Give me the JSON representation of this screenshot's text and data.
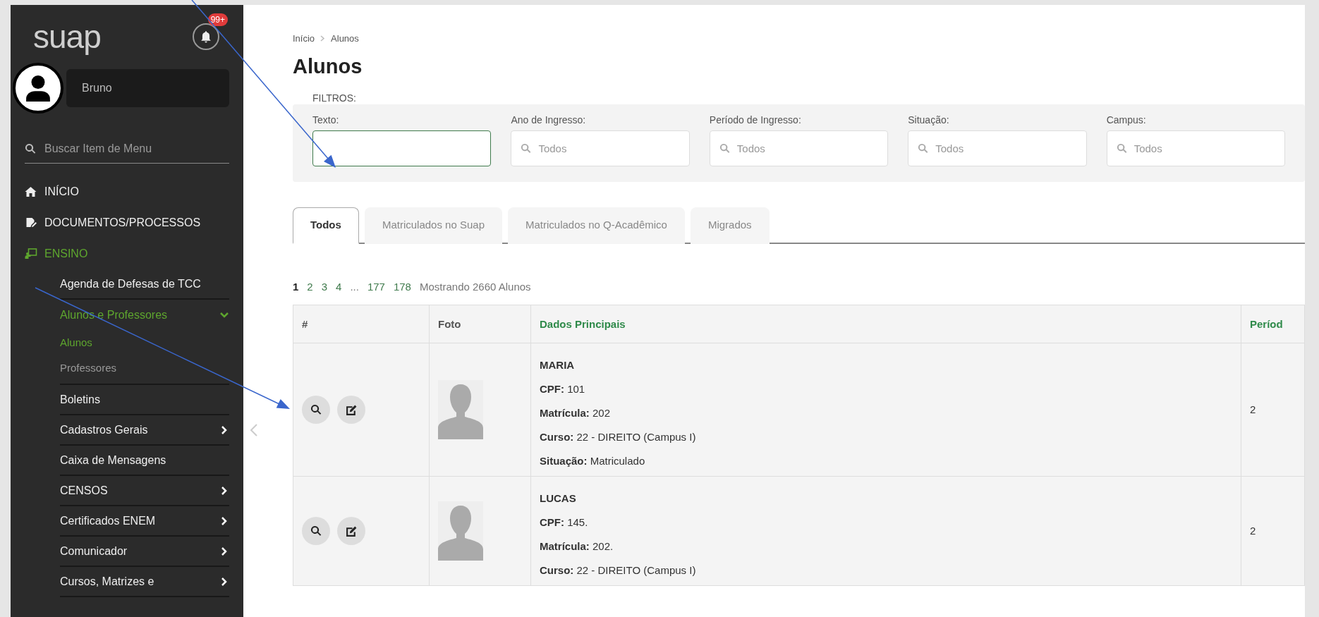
{
  "sidebar": {
    "logo": "suap",
    "notifications_badge": "99+",
    "user": {
      "name": "Bruno"
    },
    "search": {
      "placeholder": "Buscar Item de Menu"
    },
    "menu": [
      {
        "label": "INÍCIO",
        "selected": false
      },
      {
        "label": "DOCUMENTOS/PROCESSOS",
        "selected": false
      },
      {
        "label": "ENSINO",
        "selected": true,
        "children": [
          {
            "label": "Agenda de Defesas de TCC",
            "selected": false
          },
          {
            "label": "Alunos e Professores",
            "expanded": true,
            "selected": true,
            "children": [
              {
                "label": "Alunos",
                "selected": true
              },
              {
                "label": "Professores",
                "selected": false
              }
            ]
          },
          {
            "label": "Boletins",
            "selected": false
          },
          {
            "label": "Cadastros Gerais",
            "expanded": false,
            "selected": false
          },
          {
            "label": "Caixa de Mensagens",
            "selected": false
          },
          {
            "label": "CENSOS",
            "expanded": false,
            "selected": false
          },
          {
            "label": "Certificados ENEM",
            "expanded": false,
            "selected": false
          },
          {
            "label": "Comunicador",
            "expanded": false,
            "selected": false
          },
          {
            "label": "Cursos, Matrizes e",
            "expanded": false,
            "selected": false
          }
        ]
      }
    ]
  },
  "breadcrumb": [
    "Início",
    "Alunos"
  ],
  "title": "Alunos",
  "filters": {
    "label": "FILTROS:",
    "fields": [
      {
        "label": "Texto:",
        "kind": "text",
        "focused": true
      },
      {
        "label": "Ano de Ingresso:",
        "kind": "search",
        "placeholder": "Todos",
        "focused": false
      },
      {
        "label": "Período de Ingresso:",
        "kind": "search",
        "placeholder": "Todos",
        "focused": false
      },
      {
        "label": "Situação:",
        "kind": "search",
        "placeholder": "Todos",
        "focused": false
      },
      {
        "label": "Campus:",
        "kind": "search",
        "placeholder": "Todos",
        "focused": false
      }
    ]
  },
  "tabs": [
    {
      "label": "Todos",
      "selected": true
    },
    {
      "label": "Matriculados no Suap",
      "selected": false
    },
    {
      "label": "Matriculados no Q-Acadêmico",
      "selected": false
    },
    {
      "label": "Migrados",
      "selected": false
    }
  ],
  "pagination": {
    "pages": [
      {
        "label": "1",
        "kind": "page",
        "selected": true
      },
      {
        "label": "2",
        "kind": "page",
        "selected": false
      },
      {
        "label": "3",
        "kind": "page",
        "selected": false
      },
      {
        "label": "4",
        "kind": "page",
        "selected": false
      },
      {
        "label": "...",
        "kind": "ellipsis"
      },
      {
        "label": "177",
        "kind": "page",
        "selected": false
      },
      {
        "label": "178",
        "kind": "page",
        "selected": false
      }
    ],
    "summary": "Mostrando 2660 Alunos"
  },
  "table": {
    "columns": [
      {
        "label": "#",
        "sortable": false
      },
      {
        "label": "Foto",
        "sortable": false
      },
      {
        "label": "Dados Principais",
        "sortable": true
      },
      {
        "label": "Períod",
        "sortable": true
      }
    ],
    "rows": [
      {
        "name": "MARIA",
        "fields": [
          {
            "label": "CPF:",
            "value": "101"
          },
          {
            "label": "Matrícula:",
            "value": "202"
          },
          {
            "label": "Curso:",
            "value": "22 - DIREITO (Campus I)"
          },
          {
            "label": "Situação:",
            "value": "Matriculado"
          }
        ],
        "periodo": "2"
      },
      {
        "name": "LUCAS",
        "fields": [
          {
            "label": "CPF:",
            "value": "145."
          },
          {
            "label": "Matrícula:",
            "value": "202."
          },
          {
            "label": "Curso:",
            "value": "22 - DIREITO (Campus I)"
          }
        ],
        "periodo": "2"
      }
    ]
  }
}
